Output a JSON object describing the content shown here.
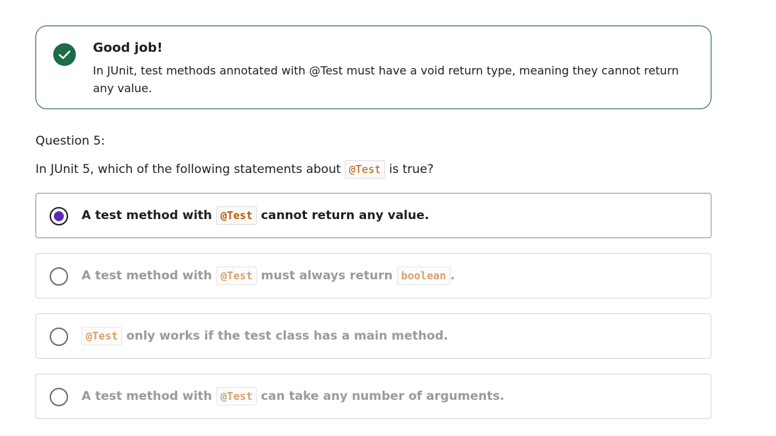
{
  "feedback": {
    "title": "Good job!",
    "message": "In JUnit, test methods annotated with @Test must have a void return type, meaning they cannot return any value.",
    "icon": "check-circle-icon",
    "accent_color": "#1d6b47"
  },
  "question": {
    "number_label": "Question 5:",
    "text_before": "In JUnit 5, which of the following statements about",
    "code": "@Test",
    "text_after": "is true?"
  },
  "options": [
    {
      "selected": true,
      "before": "A test method with",
      "code1": "@Test",
      "middle": "cannot return any value.",
      "code2": null,
      "after": null
    },
    {
      "selected": false,
      "before": "A test method with",
      "code1": "@Test",
      "middle": "must always return",
      "code2": "boolean",
      "after": "."
    },
    {
      "selected": false,
      "before": null,
      "code1": "@Test",
      "middle": "only works if the test class has a main method.",
      "code2": null,
      "after": null
    },
    {
      "selected": false,
      "before": "A test method with",
      "code1": "@Test",
      "middle": "can take any number of arguments.",
      "code2": null,
      "after": null
    }
  ],
  "colors": {
    "selected_radio": "#5b2ab3",
    "code_text": "#b35c00"
  }
}
